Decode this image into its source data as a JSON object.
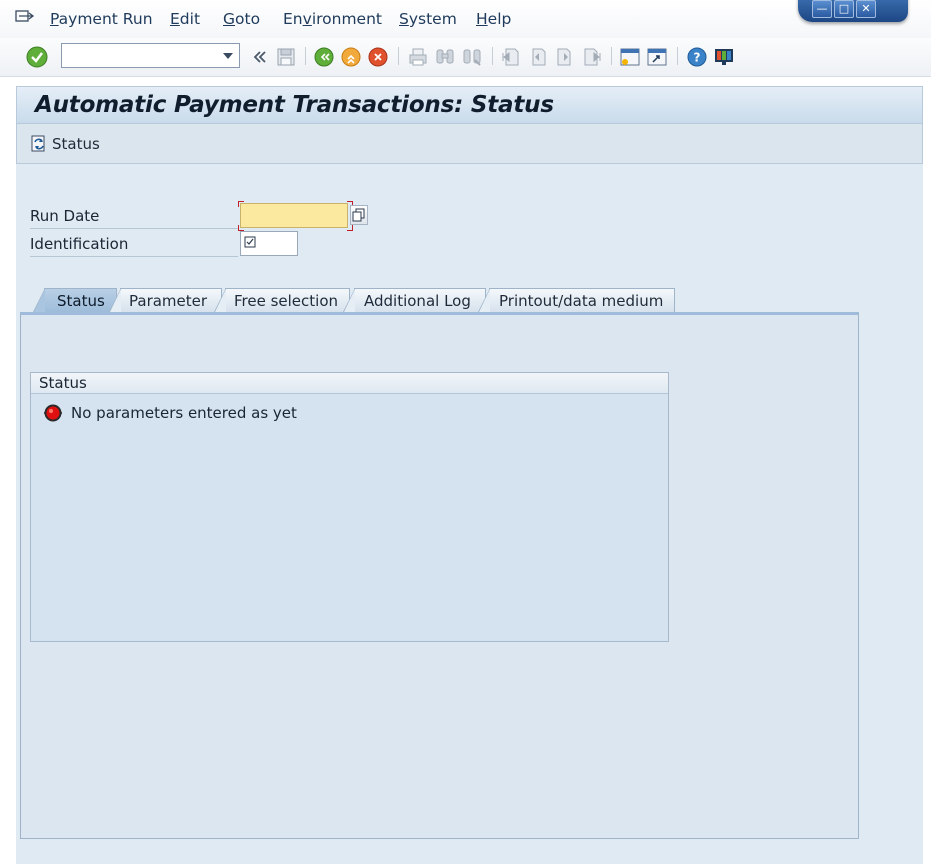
{
  "menubar": {
    "items": [
      "Payment Run",
      "Edit",
      "Goto",
      "Environment",
      "System",
      "Help"
    ],
    "underline_chars": [
      "P",
      "E",
      "G",
      "v",
      "S",
      "H"
    ]
  },
  "toolbar": {
    "command_field_value": "",
    "icons": [
      "enter-icon",
      "back-double-icon",
      "save-icon",
      "back-icon",
      "exit-icon",
      "cancel-icon",
      "print-icon",
      "find-icon",
      "find-next-icon",
      "first-page-icon",
      "previous-page-icon",
      "next-page-icon",
      "last-page-icon",
      "create-session-icon",
      "shortcut-icon",
      "help-icon",
      "customize-layout-icon"
    ]
  },
  "title": "Automatic Payment Transactions: Status",
  "application_toolbar": {
    "status_button_label": "Status"
  },
  "form": {
    "run_date_label": "Run Date",
    "run_date_value": "",
    "identification_label": "Identification",
    "identification_value": ""
  },
  "tabs": {
    "items": [
      "Status",
      "Parameter",
      "Free selection",
      "Additional Log",
      "Printout/data medium"
    ],
    "active": "Status"
  },
  "status_group": {
    "title": "Status",
    "message": "No parameters entered as yet",
    "indicator_color": "#e01010"
  },
  "colors": {
    "title_bar": "#d3e1ee",
    "required_field": "#fce9a0",
    "panel": "#dbe6f0"
  }
}
